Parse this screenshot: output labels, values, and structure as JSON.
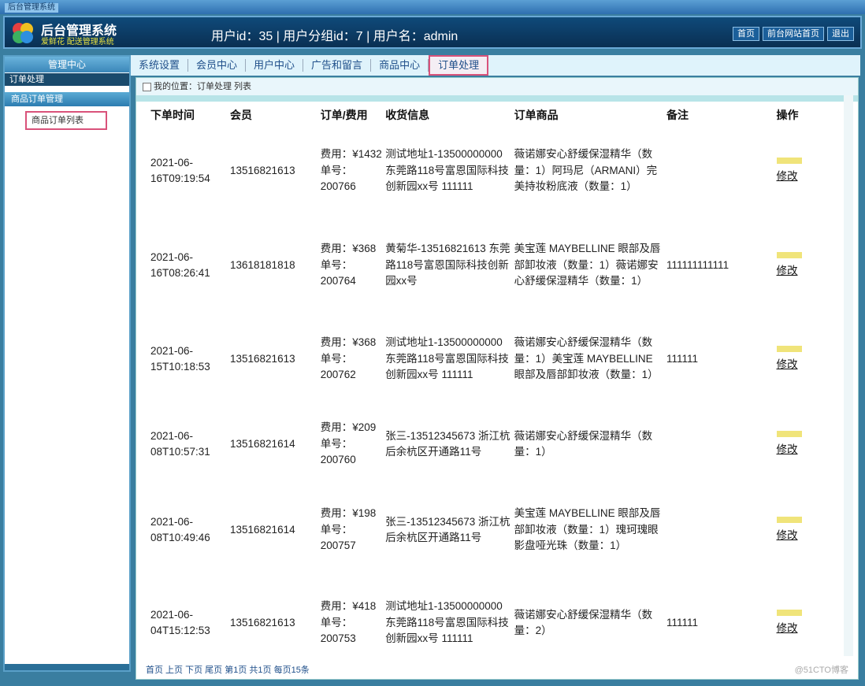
{
  "window": {
    "title": "后台管理系统"
  },
  "header": {
    "system_name": "后台管理系统",
    "system_sub": "爱鲜花 配送管理系统",
    "user_info": "用户id：35 | 用户分组id：7 | 用户名：admin",
    "buttons": [
      "首页",
      "前台网站首页",
      "退出"
    ]
  },
  "sidebar": {
    "title": "管理中心",
    "section": "订单处理",
    "group": "商品订单管理",
    "item": "商品订单列表"
  },
  "tabs": [
    "系统设置",
    "会员中心",
    "用户中心",
    "广告和留言",
    "商品中心",
    "订单处理"
  ],
  "breadcrumb": "我的位置：订单处理 列表",
  "table": {
    "headers": [
      "下单时间",
      "会员",
      "订单/费用",
      "收货信息",
      "订单商品",
      "备注",
      "操作"
    ],
    "rows": [
      {
        "time": "2021-06-16T09:19:54",
        "member": "13516821613",
        "fee": "费用：¥1432",
        "no": "单号：200766",
        "addr": "测试地址1-13500000000 东莞路118号富恩国际科技创新园xx号 111111",
        "goods": "薇诺娜安心舒缓保湿精华（数量：1）阿玛尼（ARMANI）完美持妆粉底液（数量：1）",
        "note": "",
        "op": "修改"
      },
      {
        "time": "2021-06-16T08:26:41",
        "member": "13618181818",
        "fee": "费用：¥368",
        "no": "单号：200764",
        "addr": "黄菊华-13516821613 东莞路118号富恩国际科技创新园xx号",
        "goods": "美宝莲 MAYBELLINE 眼部及唇部卸妆液（数量：1）薇诺娜安心舒缓保湿精华（数量：1）",
        "note": "111111111111",
        "op": "修改"
      },
      {
        "time": "2021-06-15T10:18:53",
        "member": "13516821613",
        "fee": "费用：¥368",
        "no": "单号：200762",
        "addr": "测试地址1-13500000000 东莞路118号富恩国际科技创新园xx号 111111",
        "goods": "薇诺娜安心舒缓保湿精华（数量：1）美宝莲 MAYBELLINE 眼部及唇部卸妆液（数量：1）",
        "note": "111111",
        "op": "修改"
      },
      {
        "time": "2021-06-08T10:57:31",
        "member": "13516821614",
        "fee": "费用：¥209",
        "no": "单号：200760",
        "addr": "张三-13512345673 浙江杭后余杭区开通路11号",
        "goods": "薇诺娜安心舒缓保湿精华（数量：1）",
        "note": "",
        "op": "修改"
      },
      {
        "time": "2021-06-08T10:49:46",
        "member": "13516821614",
        "fee": "费用：¥198",
        "no": "单号：200757",
        "addr": "张三-13512345673 浙江杭后余杭区开通路11号",
        "goods": "美宝莲 MAYBELLINE 眼部及唇部卸妆液（数量：1）瑰珂瑰眼影盘哑光珠（数量：1）",
        "note": "",
        "op": "修改"
      },
      {
        "time": "2021-06-04T15:12:53",
        "member": "13516821613",
        "fee": "费用：¥418",
        "no": "单号：200753",
        "addr": "测试地址1-13500000000 东莞路118号富恩国际科技创新园xx号 111111",
        "goods": "薇诺娜安心舒缓保湿精华（数量：2）",
        "note": "111111",
        "op": "修改"
      }
    ]
  },
  "pager": "首页 上页 下页 尾页 第1页 共1页 每页15条",
  "brand": "@51CTO博客"
}
